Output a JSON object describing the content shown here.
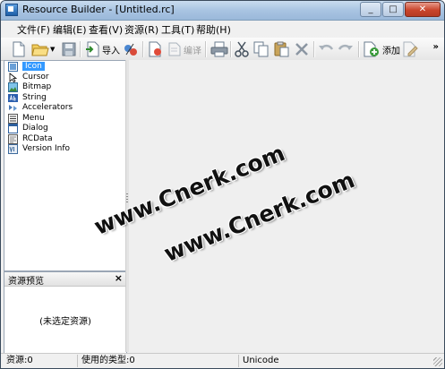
{
  "window": {
    "title": "Resource Builder - [Untitled.rc]"
  },
  "menu": [
    "文件(F)",
    "编辑(E)",
    "查看(V)",
    "资源(R)",
    "工具(T)",
    "帮助(H)"
  ],
  "toolbar": {
    "import_label": "导入",
    "compile_label": "编译",
    "add_label": "添加",
    "more": "»"
  },
  "tree": {
    "items": [
      {
        "label": "Icon",
        "icon": "icon-resource-icon",
        "selected": true
      },
      {
        "label": "Cursor",
        "icon": "cursor-resource-icon"
      },
      {
        "label": "Bitmap",
        "icon": "bitmap-resource-icon"
      },
      {
        "label": "String",
        "icon": "string-resource-icon"
      },
      {
        "label": "Accelerators",
        "icon": "accelerators-resource-icon"
      },
      {
        "label": "Menu",
        "icon": "menu-resource-icon"
      },
      {
        "label": "Dialog",
        "icon": "dialog-resource-icon"
      },
      {
        "label": "RCData",
        "icon": "rcdata-resource-icon"
      },
      {
        "label": "Version Info",
        "icon": "version-info-resource-icon"
      }
    ]
  },
  "preview": {
    "title": "资源预览",
    "close": "×",
    "empty_text": "(未选定资源)"
  },
  "watermark": {
    "line1": "www.Cnerk.com",
    "line2": "www.Cnerk.com"
  },
  "status": {
    "resources": "资源:0",
    "types": "使用的类型:0",
    "encoding": "Unicode"
  }
}
